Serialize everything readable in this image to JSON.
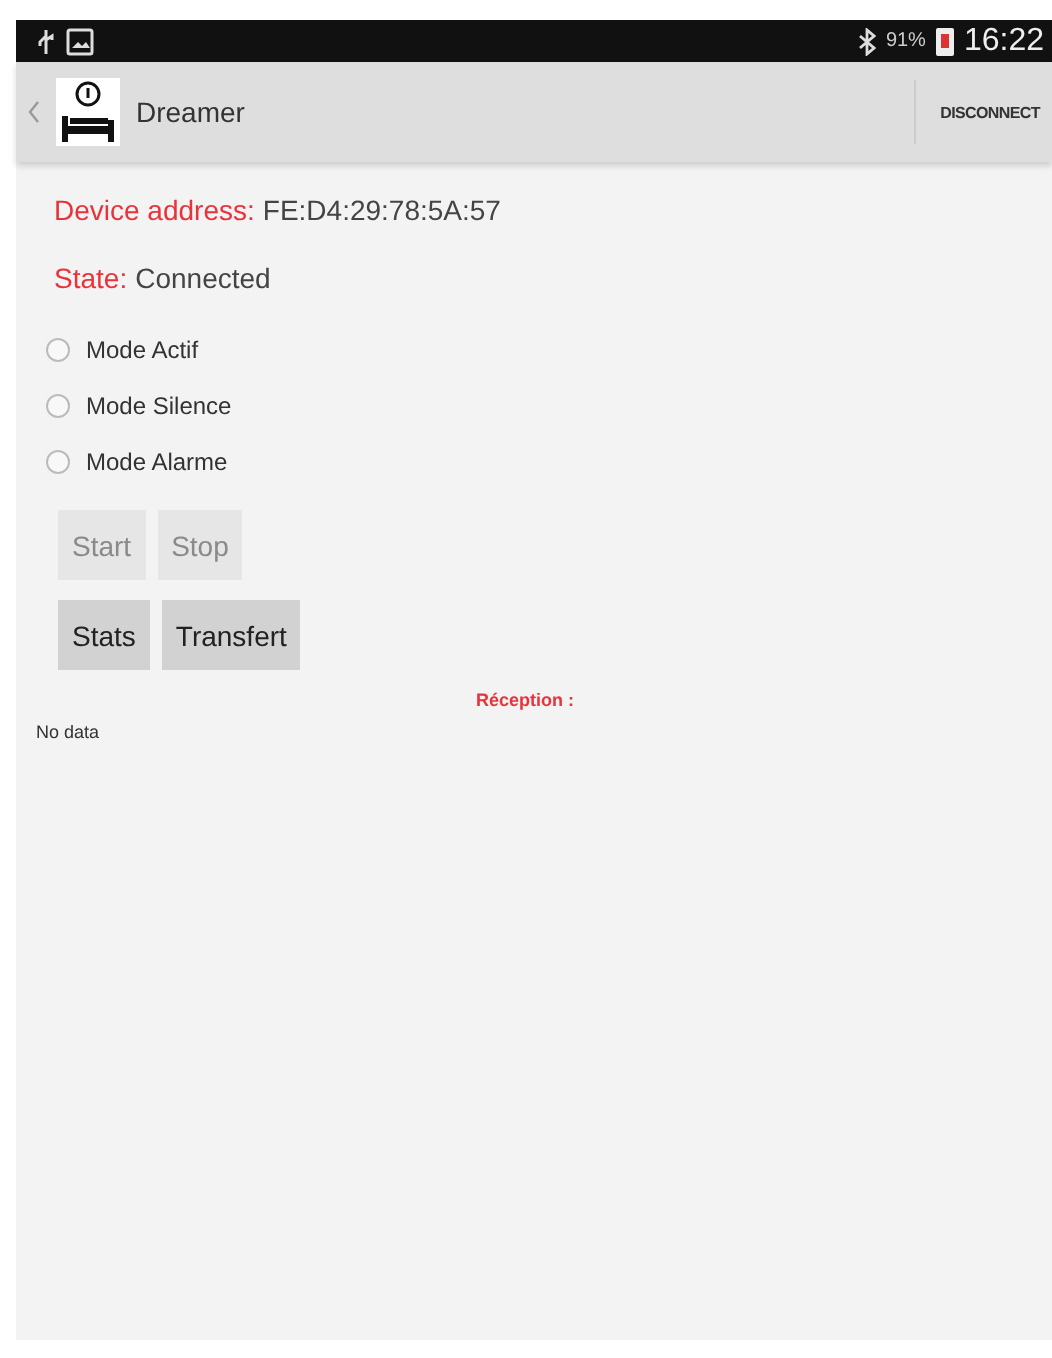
{
  "status_bar": {
    "battery_percent": "91%",
    "time": "16:22"
  },
  "app_bar": {
    "title": "Dreamer",
    "action": "DISCONNECT"
  },
  "fields": [
    {
      "label": "Device address:",
      "value": "FE:D4:29:78:5A:57"
    },
    {
      "label": "State:",
      "value": "Connected"
    }
  ],
  "modes": [
    {
      "label": "Mode Actif",
      "selected": false
    },
    {
      "label": "Mode Silence",
      "selected": false
    },
    {
      "label": "Mode Alarme",
      "selected": false
    }
  ],
  "button_rows": [
    [
      {
        "label": "Start",
        "disabled": true
      },
      {
        "label": "Stop",
        "disabled": true
      }
    ],
    [
      {
        "label": "Stats",
        "disabled": false
      },
      {
        "label": "Transfert",
        "disabled": false
      }
    ]
  ],
  "reception_label": "Réception :",
  "data_text": "No data"
}
